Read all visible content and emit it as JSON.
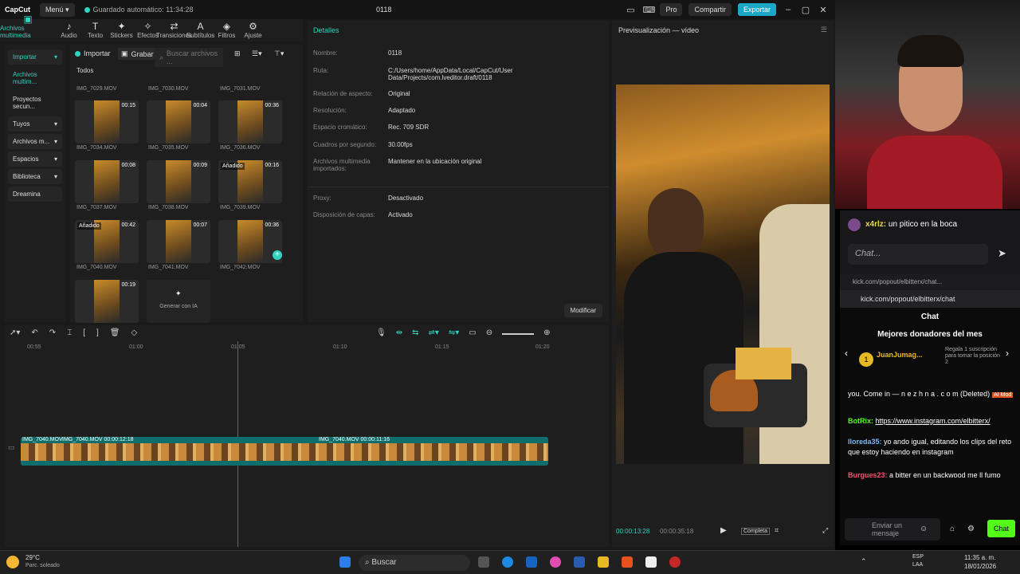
{
  "capcut": {
    "logo": "CapCut",
    "menu": "Menú",
    "saved": "Guardado automático: 11:34:28",
    "project": "0118",
    "pro": "Pro",
    "share": "Compartir",
    "export": "Exportar",
    "tools": [
      {
        "icon": "▣",
        "label": "Archivos multimedia",
        "active": true
      },
      {
        "icon": "♪",
        "label": "Audio"
      },
      {
        "icon": "T",
        "label": "Texto"
      },
      {
        "icon": "✦",
        "label": "Stickers"
      },
      {
        "icon": "✧",
        "label": "Efectos"
      },
      {
        "icon": "⇄",
        "label": "Transiciones"
      },
      {
        "icon": "A",
        "label": "Subtítulos"
      },
      {
        "icon": "◈",
        "label": "Filtros"
      },
      {
        "icon": "⚙",
        "label": "Ajuste"
      }
    ],
    "sidebar": {
      "importar": "Importar",
      "items": [
        "Archivos multim...",
        "Proyectos secun...",
        "Tuyos",
        "Archivos m...",
        "Espacios",
        "Biblioteca",
        "Dreamina"
      ]
    },
    "media": {
      "import_btn": "Importar",
      "record_btn": "Grabar",
      "search_placeholder": "Buscar archivos ...",
      "all": "Todos",
      "top_names": [
        "IMG_7029.MOV",
        "IMG_7030.MOV",
        "IMG_7031.MOV"
      ],
      "clips": [
        {
          "dur": "00:15",
          "name": "IMG_7034.MOV",
          "tag": ""
        },
        {
          "dur": "00:04",
          "name": "IMG_7035.MOV",
          "tag": ""
        },
        {
          "dur": "00:36",
          "name": "IMG_7036.MOV",
          "tag": ""
        },
        {
          "dur": "00:08",
          "name": "IMG_7037.MOV",
          "tag": ""
        },
        {
          "dur": "00:09",
          "name": "IMG_7038.MOV",
          "tag": ""
        },
        {
          "dur": "00:16",
          "name": "IMG_7039.MOV",
          "tag": "Añadido"
        },
        {
          "dur": "00:42",
          "name": "IMG_7040.MOV",
          "tag": "Añadido"
        },
        {
          "dur": "00:07",
          "name": "IMG_7041.MOV",
          "tag": ""
        },
        {
          "dur": "00:36",
          "name": "IMG_7042.MOV",
          "tag": ""
        },
        {
          "dur": "00:19",
          "name": "",
          "tag": ""
        }
      ],
      "generate_ai": "Generar con IA"
    },
    "details": {
      "header": "Detalles",
      "rows": [
        {
          "label": "Nombre:",
          "value": "0118"
        },
        {
          "label": "Ruta:",
          "value": "C:/Users/home/AppData/Local/CapCut/User Data/Projects/com.lveditor.draft/0118"
        },
        {
          "label": "Relación de aspecto:",
          "value": "Original"
        },
        {
          "label": "Resolución:",
          "value": "Adaptado"
        },
        {
          "label": "Espacio cromático:",
          "value": "Rec. 709 SDR"
        },
        {
          "label": "Cuadros por segundo:",
          "value": "30.00fps"
        },
        {
          "label": "Archivos multimedia importados:",
          "value": "Mantener en la ubicación original"
        },
        {
          "label": "Proxy:",
          "value": "Desactivado"
        },
        {
          "label": "Disposición de capas:",
          "value": "Activado"
        }
      ],
      "modify": "Modificar"
    },
    "preview": {
      "header": "Previsualización — vídeo",
      "time_current": "00:00:13:28",
      "time_total": "00:00:35:18",
      "full": "Completa"
    },
    "timeline": {
      "ruler": [
        "00:55",
        "01:00",
        "01:05",
        "01:10",
        "01:15",
        "01:20"
      ],
      "clip1": "IMG_7040.MOV",
      "clip2": "IMG_7040.MOV  00:00:12:18",
      "clip3": "IMG_7040.MOV  00:00:11:16"
    }
  },
  "stream": {
    "chat_top": {
      "user": "x4rlz:",
      "text": "un pitico en la boca",
      "placeholder": "Chat..."
    },
    "kick": {
      "tab": "kick.com/popout/elbitterx/chat...",
      "url": "kick.com/popout/elbitterx/chat",
      "title": "Chat",
      "donors_title": "Mejores donadores del mes",
      "top_donor": "JuanJumag...",
      "top_donor_rank": "1",
      "gift_prompt": "Regala 1 suscripción para tomar la posición 2",
      "messages": [
        {
          "user": "",
          "text": "you. Come in — n e z h n a . c o m (Deleted)",
          "badge": "AI Mod"
        },
        {
          "user": "BotRix:",
          "text": "https://www.instagram.com/elbitterx/"
        },
        {
          "user": "lloreda35:",
          "text": "yo ando igual, editando los clips del reto que estoy haciendo en instagram"
        },
        {
          "user": "Burgues23:",
          "text": "a bitter en un backwood me ll fumo"
        }
      ],
      "send_placeholder": "Enviar un mensaje",
      "chat_btn": "Chat"
    }
  },
  "taskbar": {
    "weather_temp": "29°C",
    "weather_desc": "Parc. soleado",
    "search": "Buscar",
    "lang": "ESP",
    "lang2": "LAA",
    "time": "11:35 a. m.",
    "date": "18/01/2026"
  },
  "colors": {
    "accent": "#2dd4bf",
    "kick_green": "#53fc18",
    "export_blue": "#1aa7c8"
  }
}
